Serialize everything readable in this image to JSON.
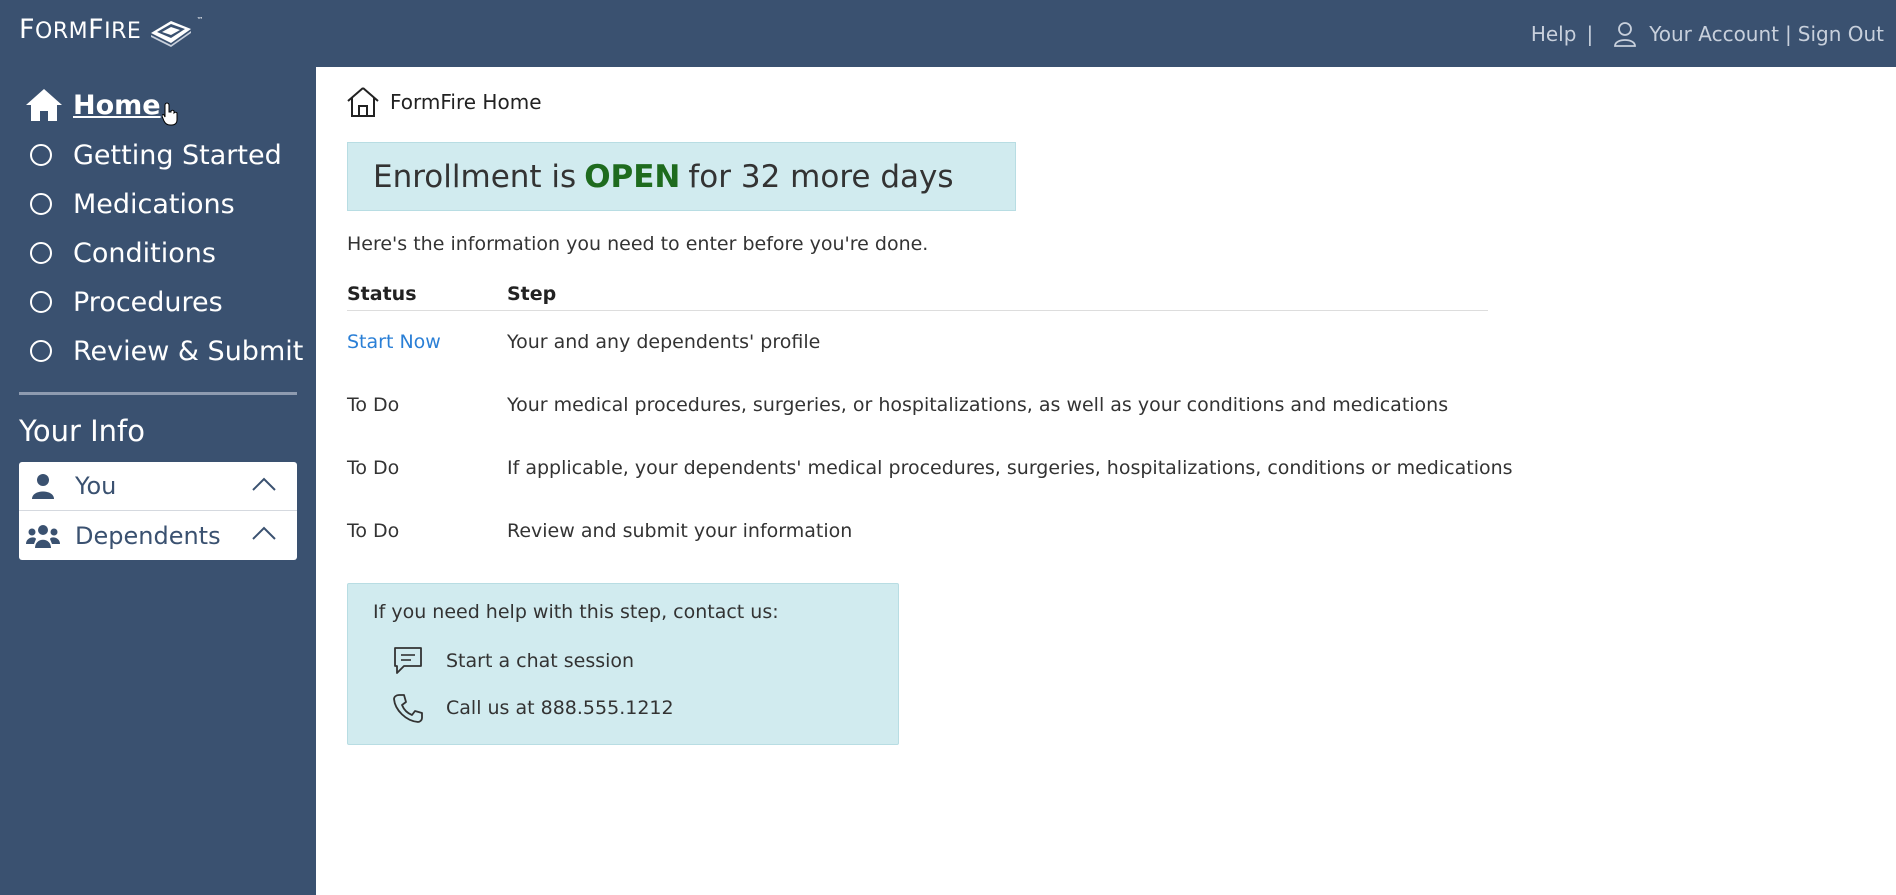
{
  "header": {
    "logo_text_f": "F",
    "logo_text_orm": "ORM",
    "logo_text_f2": "F",
    "logo_text_ire": "IRE",
    "logo_tm": "™",
    "help_link": "Help",
    "separator": "|",
    "account_link": "Your Account",
    "sign_out_link": "Sign Out",
    "colors": {
      "bar": "#3a5170"
    }
  },
  "sidebar": {
    "home_label": "Home",
    "items": [
      {
        "label": "Getting Started"
      },
      {
        "label": "Medications"
      },
      {
        "label": "Conditions"
      },
      {
        "label": "Procedures"
      },
      {
        "label": "Review & Submit"
      }
    ],
    "your_info_title": "Your Info",
    "info_items": [
      {
        "label": "You",
        "icon": "user-icon"
      },
      {
        "label": "Dependents",
        "icon": "users-icon"
      }
    ]
  },
  "main": {
    "breadcrumb": "FormFire Home",
    "banner": {
      "prefix": "Enrollment is",
      "status": "OPEN",
      "suffix": "for 32 more days",
      "status_color": "#1e6b1e"
    },
    "intro": "Here's the information you need to enter before you're done.",
    "steps_header": {
      "status": "Status",
      "step": "Step"
    },
    "steps": [
      {
        "status": "Start Now",
        "step": "Your and any dependents' profile"
      },
      {
        "status": "To Do",
        "step": "Your medical procedures, surgeries, or hospitalizations, as well as your conditions and medications"
      },
      {
        "status": "To Do",
        "step": "If applicable, your dependents' medical procedures, surgeries, hospitalizations, conditions or medications"
      },
      {
        "status": "To Do",
        "step": "Review and submit your information"
      }
    ],
    "help": {
      "title": "If you need help with this step, contact us:",
      "chat": "Start a chat session",
      "call": "Call us at 888.555.1212"
    }
  }
}
